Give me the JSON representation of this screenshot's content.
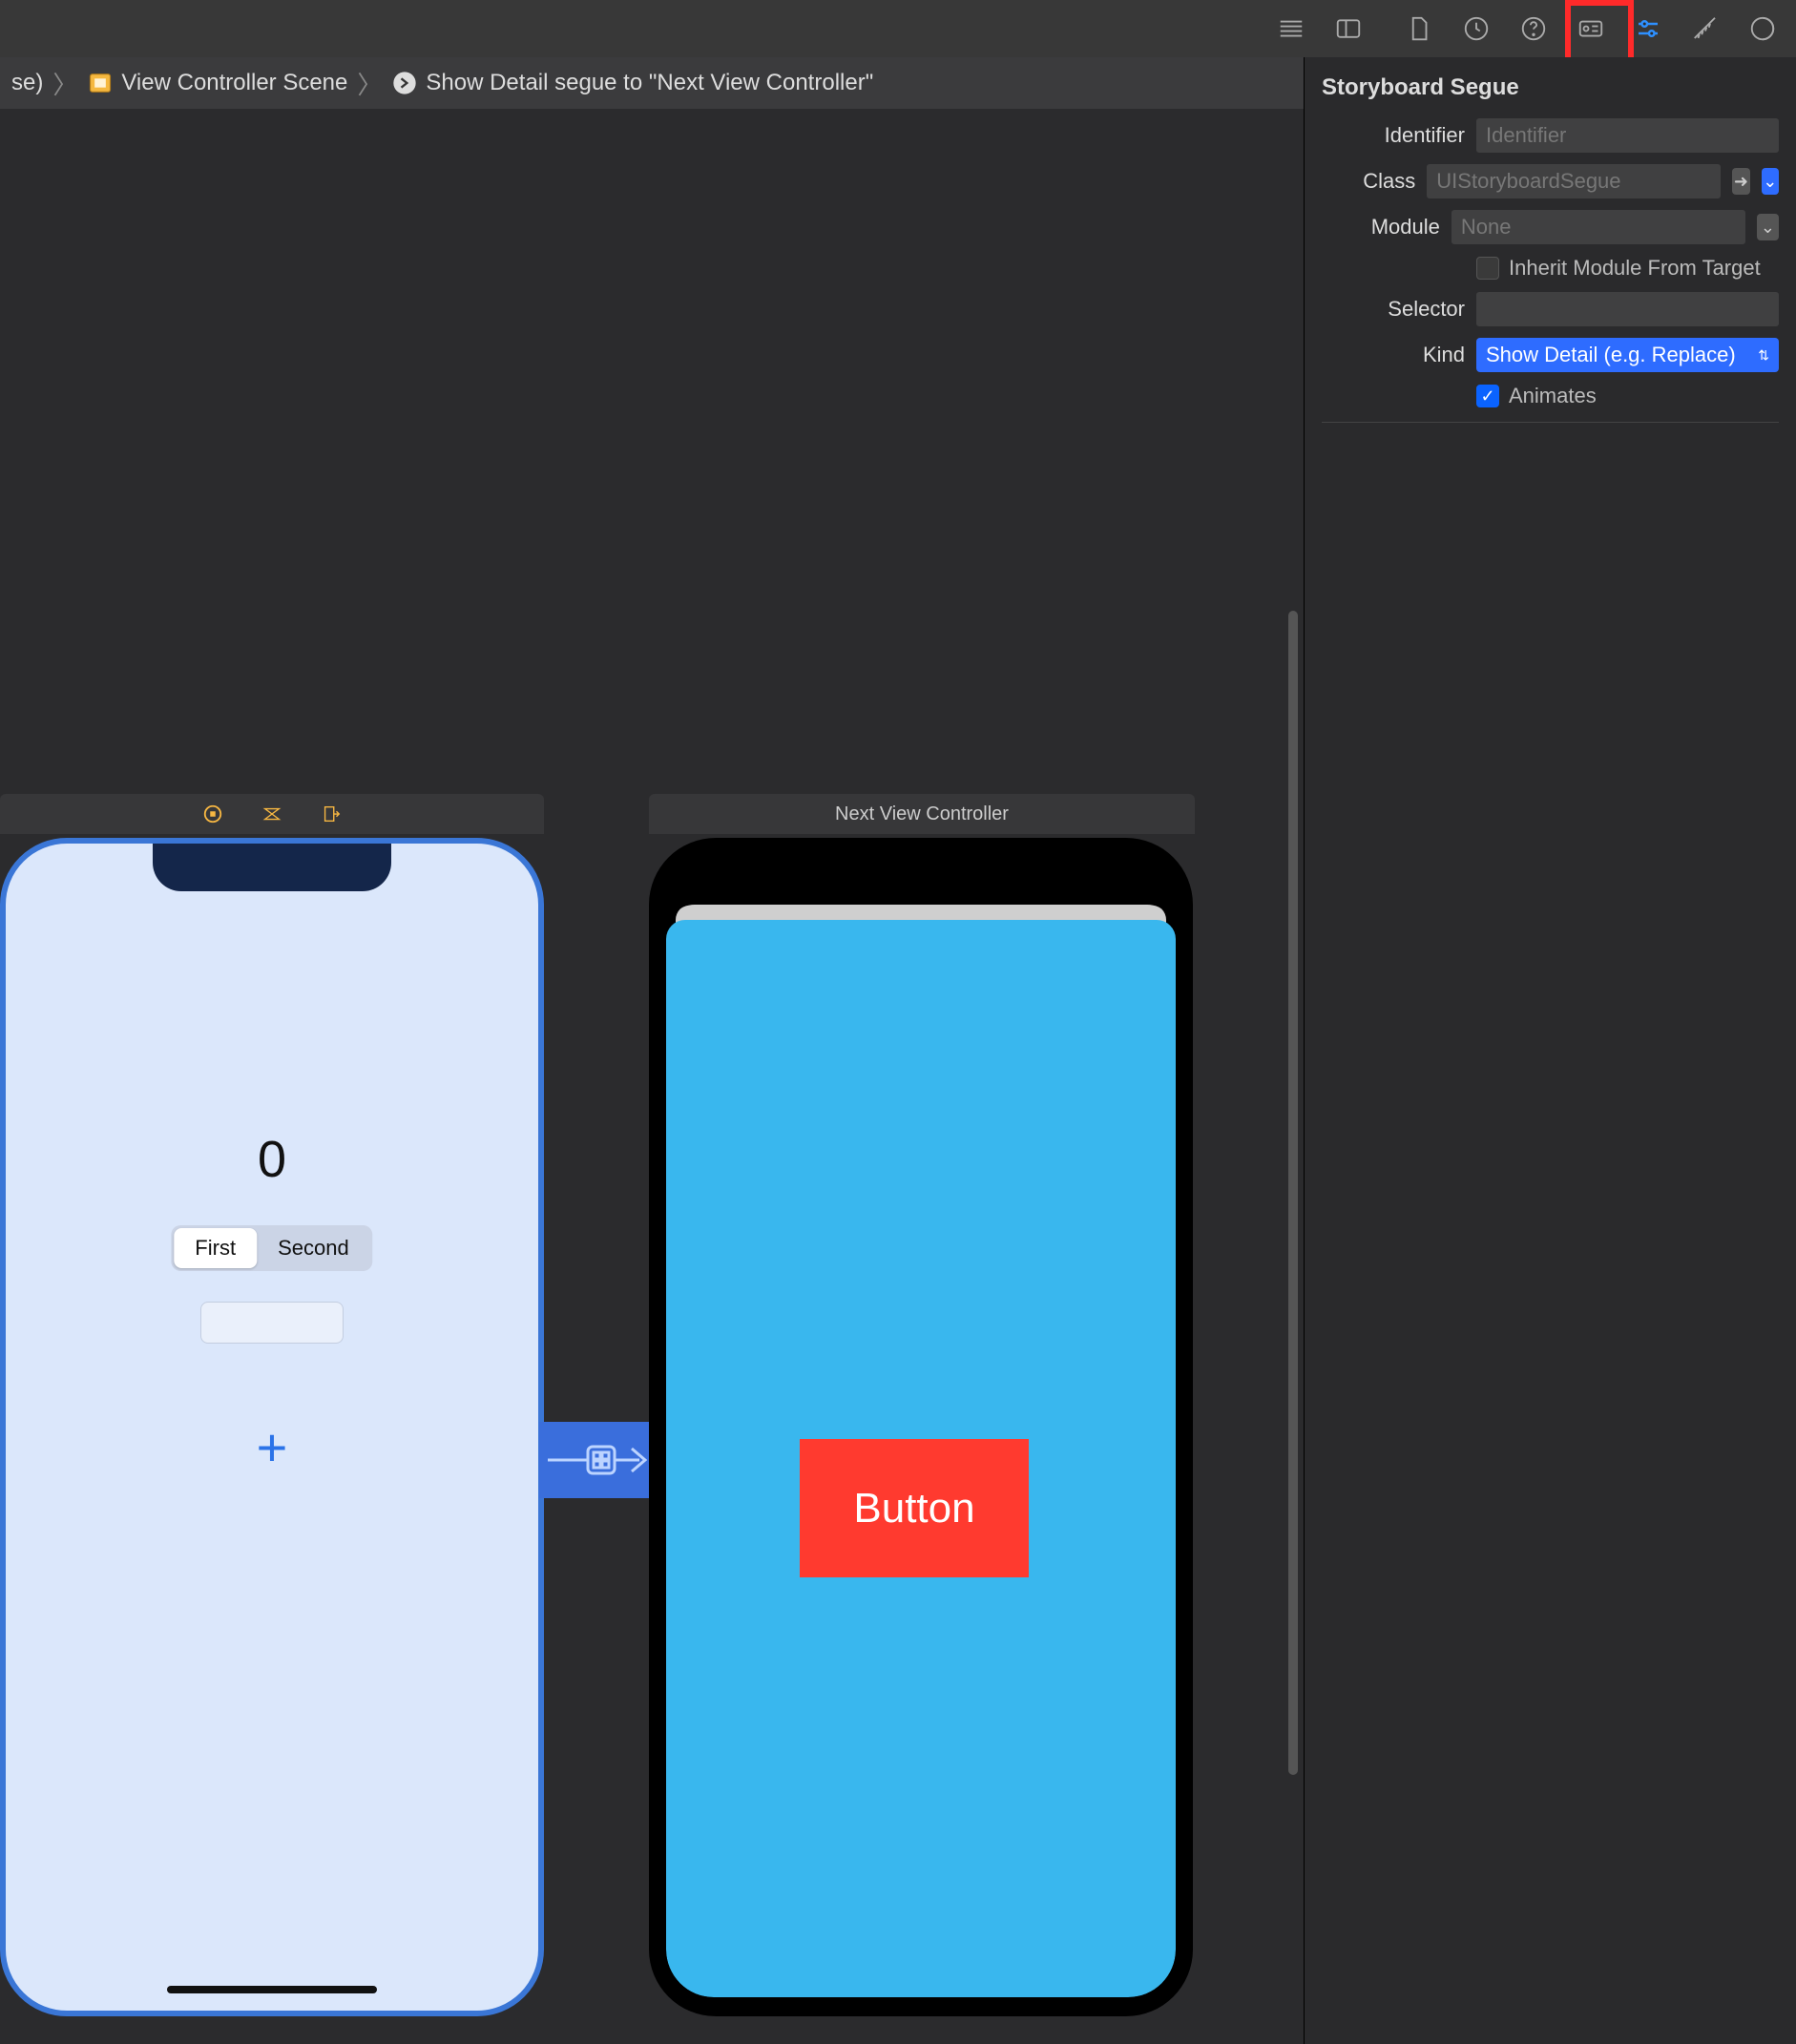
{
  "breadcrumbs": {
    "item0_suffix": "se)",
    "item1": "View Controller Scene",
    "item2": "Show Detail segue to \"Next View Controller\""
  },
  "inspector": {
    "section_title": "Storyboard Segue",
    "identifier_label": "Identifier",
    "identifier_placeholder": "Identifier",
    "identifier_value": "",
    "class_label": "Class",
    "class_placeholder": "UIStoryboardSegue",
    "class_value": "",
    "module_label": "Module",
    "module_value": "None",
    "inherit_label": "Inherit Module From Target",
    "inherit_checked": false,
    "selector_label": "Selector",
    "selector_value": "",
    "kind_label": "Kind",
    "kind_value": "Show Detail (e.g. Replace)",
    "animates_label": "Animates",
    "animates_checked": true
  },
  "scenes": {
    "vc_title": "",
    "next_title": "Next View Controller"
  },
  "phone1": {
    "counter": "0",
    "seg1": "First",
    "seg2": "Second",
    "plus": "+"
  },
  "phone2": {
    "button_label": "Button"
  }
}
